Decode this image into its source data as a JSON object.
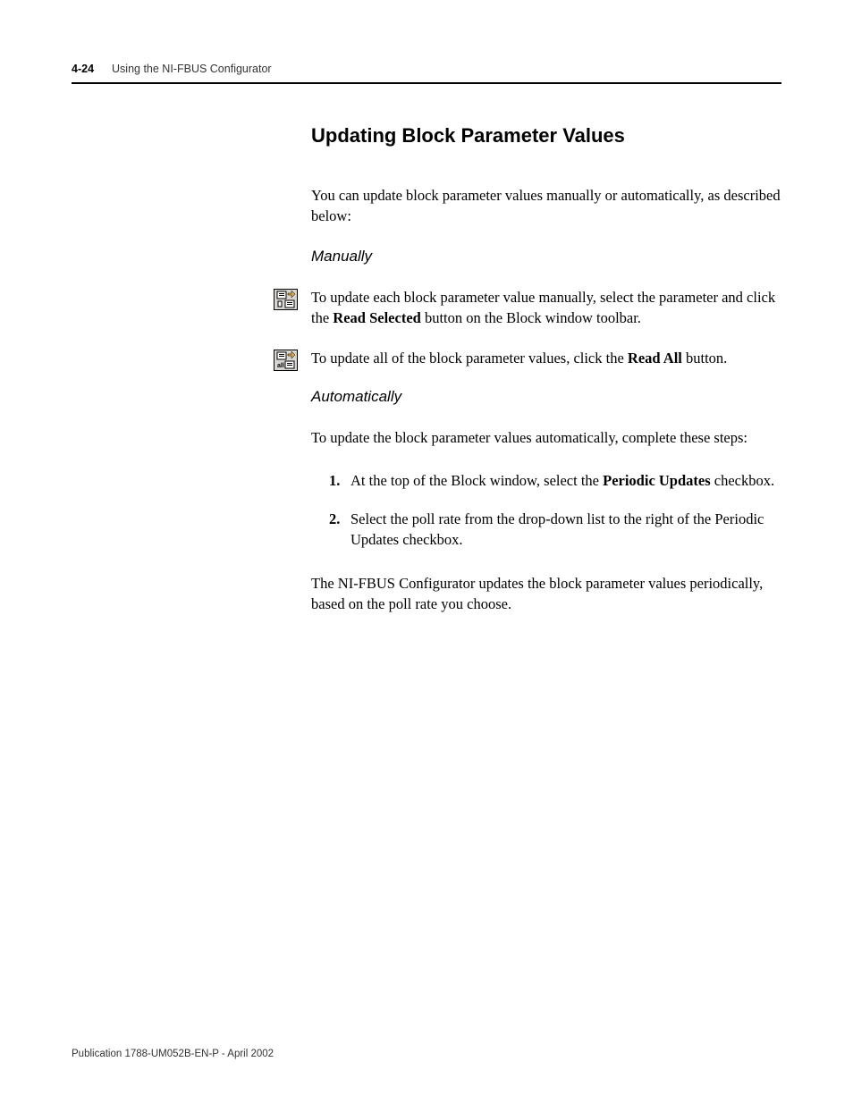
{
  "header": {
    "page_num": "4-24",
    "title": "Using the NI-FBUS Configurator"
  },
  "section": {
    "title": "Updating Block Parameter Values",
    "intro": "You can update block parameter values manually or automatically, as described below:"
  },
  "manually": {
    "heading": "Manually",
    "p1_a": "To update each block parameter value manually, select the parameter and click the ",
    "p1_b_bold": "Read Selected",
    "p1_c": " button on the Block window toolbar.",
    "p2_a": "To update all of the block parameter values, click the ",
    "p2_b_bold": "Read All",
    "p2_c": " button."
  },
  "automatically": {
    "heading": "Automatically",
    "intro": "To update the block parameter values automatically, complete these steps:",
    "step1_num": "1.",
    "step1_a": "At the top of the Block window, select the ",
    "step1_b_bold": "Periodic Updates",
    "step1_c": " checkbox.",
    "step2_num": "2.",
    "step2": "Select the poll rate from the drop-down list to the right of the Periodic Updates checkbox.",
    "closing": "The NI-FBUS Configurator updates the block parameter values periodically, based on the poll rate you choose."
  },
  "footer": "Publication 1788-UM052B-EN-P - April 2002"
}
